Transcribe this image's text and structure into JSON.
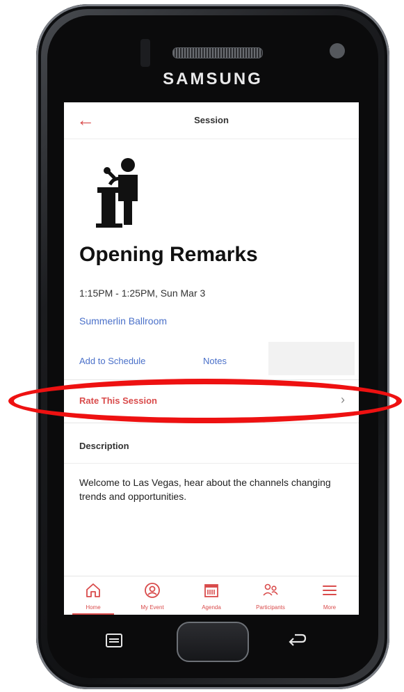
{
  "device": {
    "brand": "SAMSUNG"
  },
  "header": {
    "title": "Session",
    "back_icon": "arrow-left-icon"
  },
  "session": {
    "icon": "speaker-at-podium-icon",
    "title": "Opening Remarks",
    "time": "1:15PM - 1:25PM, Sun Mar 3",
    "location": "Summerlin Ballroom"
  },
  "actions": {
    "add_to_schedule": "Add to Schedule",
    "notes": "Notes"
  },
  "rate": {
    "label": "Rate This Session",
    "chevron": "›"
  },
  "description": {
    "label": "Description",
    "text": "Welcome to Las Vegas, hear about the channels changing trends and opportunities."
  },
  "tabbar": {
    "items": [
      {
        "label": "Home",
        "icon": "home-icon",
        "active": true
      },
      {
        "label": "My Event",
        "icon": "user-circle-icon",
        "active": false
      },
      {
        "label": "Agenda",
        "icon": "calendar-icon",
        "active": false
      },
      {
        "label": "Participants",
        "icon": "people-icon",
        "active": false
      },
      {
        "label": "More",
        "icon": "menu-icon",
        "active": false
      }
    ]
  },
  "colors": {
    "accent": "#d94b4b",
    "link": "#4a70c9",
    "highlight": "#ee1111"
  }
}
